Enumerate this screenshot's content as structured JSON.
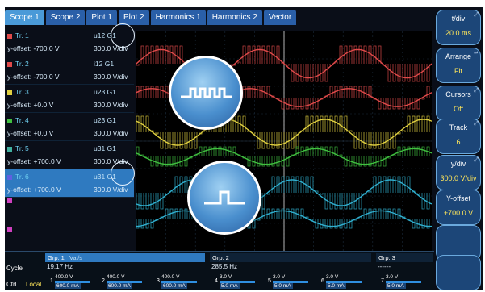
{
  "tabs": [
    "Scope 1",
    "Scope 2",
    "Plot 1",
    "Plot 2",
    "Harmonics 1",
    "Harmonics 2",
    "Vector"
  ],
  "traces": [
    {
      "name": "Tr. 1",
      "signal": "u12 G1",
      "offset": "y-offset: -700.0 V",
      "scale": "300.0 V/div",
      "color": "#e04a4a"
    },
    {
      "name": "Tr. 2",
      "signal": "i12 G1",
      "offset": "y-offset: -700.0 V",
      "scale": "300.0 V/div",
      "color": "#e04a4a"
    },
    {
      "name": "Tr. 3",
      "signal": "u23 G1",
      "offset": "y-offset: +0.0 V",
      "scale": "300.0 V/div",
      "color": "#e0d040"
    },
    {
      "name": "Tr. 4",
      "signal": "u23 G1",
      "offset": "y-offset: +0.0 V",
      "scale": "300.0 V/div",
      "color": "#40c040"
    },
    {
      "name": "Tr. 5",
      "signal": "u31 G1",
      "offset": "y-offset: +700.0 V",
      "scale": "300.0 V/div",
      "color": "#40b0a0"
    },
    {
      "name": "Tr. 6",
      "signal": "u31 G1",
      "offset": "y-offset: +700.0 V",
      "scale": "300.0 V/div",
      "color": "#6060e0"
    }
  ],
  "extra_trace_colors": [
    "#d040c0",
    "#d040c0"
  ],
  "right_buttons": [
    {
      "label": "t/div",
      "value": "20.0 ms"
    },
    {
      "label": "Arrange",
      "value": "Fit"
    },
    {
      "label": "Cursors",
      "value": "Off"
    },
    {
      "label": "Track",
      "value": "6"
    },
    {
      "label": "y/div",
      "value": "300.0 V/div"
    },
    {
      "label": "Y-offset",
      "value": "+700.0 V"
    },
    {
      "label": "",
      "value": ""
    },
    {
      "label": "",
      "value": ""
    }
  ],
  "bottom": {
    "cycle_label": "Cycle",
    "ctrl_label": "Ctrl",
    "local_label": "Local",
    "groups": [
      {
        "title": "Grp. 1",
        "sub": "Val/s",
        "value": "19.17  Hz"
      },
      {
        "title": "Grp. 2",
        "sub": "",
        "value": "285.5  Hz"
      },
      {
        "title": "Grp. 3",
        "sub": "",
        "value": "------"
      }
    ],
    "channels": [
      {
        "num": "1",
        "v": "400.0 V",
        "a": "600.0 mA"
      },
      {
        "num": "2",
        "v": "400.0 V",
        "a": "600.0 mA"
      },
      {
        "num": "3",
        "v": "400.0 V",
        "a": "600.0 mA"
      },
      {
        "num": "4",
        "v": "3.0 V",
        "a": "5.0 mA"
      },
      {
        "num": "5",
        "v": "3.0 V",
        "a": "5.0 mA"
      },
      {
        "num": "6",
        "v": "3.0 V",
        "a": "5.0 mA"
      },
      {
        "num": "7",
        "v": "3.0 V",
        "a": "5.0 mA"
      }
    ]
  },
  "colors": {
    "trace_red": "#e04a4a",
    "trace_yellow": "#e0d040",
    "trace_green": "#40c040",
    "trace_cyan": "#30b0d0",
    "panel_blue": "#1c4678",
    "tab_active": "#4a9ad8"
  },
  "icons": [
    "pulse-train-icon",
    "step-pulse-icon",
    "lens-highlight-icon"
  ]
}
